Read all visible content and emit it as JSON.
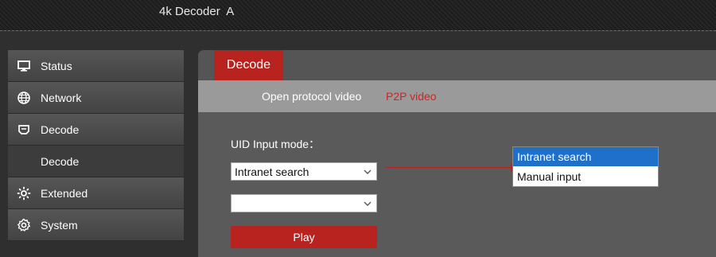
{
  "header": {
    "title": "4k Decoder  A"
  },
  "sidebar": {
    "items": [
      {
        "label": "Status",
        "icon": "monitor-icon"
      },
      {
        "label": "Network",
        "icon": "globe-icon"
      },
      {
        "label": "Decode",
        "icon": "decoder-icon"
      },
      {
        "label": "Decode",
        "icon": ""
      },
      {
        "label": "Extended",
        "icon": "extended-gear-icon"
      },
      {
        "label": "System",
        "icon": "gear-icon"
      }
    ]
  },
  "panel": {
    "tab_label": "Decode",
    "subtabs": [
      "Open protocol video",
      "P2P video"
    ],
    "uid_label": "UID Input mode：",
    "mode_select_value": "Intranet search",
    "second_select_value": "",
    "play_label": "Play"
  },
  "dropdown": {
    "options": [
      "Intranet search",
      "Manual input"
    ],
    "selected": "Intranet search"
  },
  "colors": {
    "accent_red": "#b8231f",
    "active_subtab": "#d2231e",
    "selected_option": "#1e70c9"
  }
}
